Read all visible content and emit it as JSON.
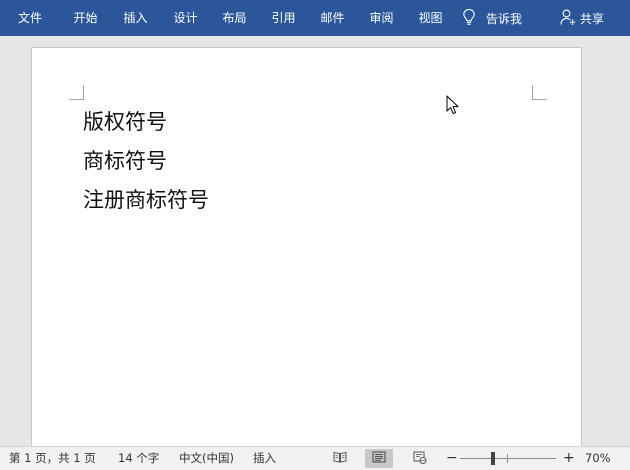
{
  "ribbon": {
    "tabs": [
      "文件",
      "开始",
      "插入",
      "设计",
      "布局",
      "引用",
      "邮件",
      "审阅",
      "视图"
    ],
    "tell_me": "告诉我",
    "share": "共享"
  },
  "document": {
    "lines": [
      "版权符号",
      "商标符号",
      "注册商标符号"
    ]
  },
  "status_bar": {
    "page": "第 1 页，共 1 页",
    "words": "14 个字",
    "language": "中文(中国)",
    "mode": "插入",
    "zoom_minus": "−",
    "zoom_plus": "+",
    "zoom_percent": "70%",
    "zoom_level": 70
  },
  "colors": {
    "ribbon": "#2b579a",
    "page": "#ffffff",
    "background": "#e6e6e6",
    "status_bar": "#f1f1f1"
  },
  "icons": {
    "tell_me": "lightbulb-icon",
    "share": "person-add-icon",
    "read_mode": "book-icon",
    "print_layout": "page-lines-icon",
    "web_layout": "web-layout-icon",
    "pointer": "mouse-pointer-icon"
  }
}
